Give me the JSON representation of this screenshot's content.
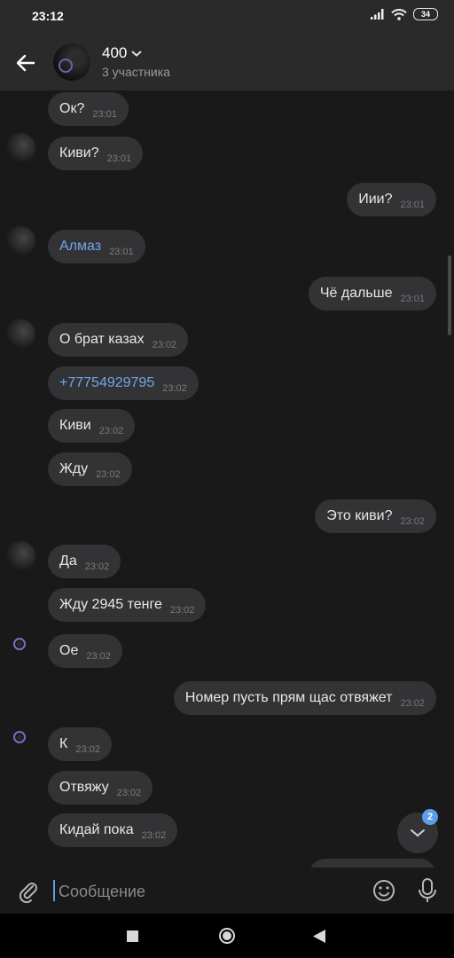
{
  "status_bar": {
    "time": "23:12",
    "battery": "34"
  },
  "header": {
    "title": "400",
    "subtitle": "3 участника",
    "icons": [
      "back-arrow-icon",
      "chevron-down-icon"
    ]
  },
  "messages": [
    {
      "side": "in",
      "text": "Ок?",
      "time": "23:01"
    },
    {
      "side": "in",
      "text": "Киви?",
      "time": "23:01"
    },
    {
      "side": "out",
      "text": "Иии?",
      "time": "23:01"
    },
    {
      "side": "in",
      "text": "Алмаз",
      "time": "23:01",
      "link": true
    },
    {
      "side": "out",
      "text": "Чё дальше",
      "time": "23:01"
    },
    {
      "side": "in",
      "text": "О брат казах",
      "time": "23:02"
    },
    {
      "side": "in",
      "text": "+77754929795",
      "time": "23:02",
      "link": true
    },
    {
      "side": "in",
      "text": "Киви",
      "time": "23:02"
    },
    {
      "side": "in",
      "text": "Жду",
      "time": "23:02"
    },
    {
      "side": "out",
      "text": "Это киви?",
      "time": "23:02"
    },
    {
      "side": "in",
      "text": "Да",
      "time": "23:02"
    },
    {
      "side": "in",
      "text": "Жду 2945 тенге",
      "time": "23:02"
    },
    {
      "side": "in",
      "text": "Ое",
      "time": "23:02"
    },
    {
      "side": "out",
      "text": "Номер пусть прям щас отвяжет",
      "time": "23:02"
    },
    {
      "side": "in",
      "text": "К",
      "time": "23:02"
    },
    {
      "side": "in",
      "text": "Отвяжу",
      "time": "23:02"
    },
    {
      "side": "in",
      "text": "Кидай пока",
      "time": "23:02"
    }
  ],
  "scroll_down": {
    "badge": "2",
    "icon": "chevron-down-icon"
  },
  "composer": {
    "placeholder": "Сообщение",
    "icons": [
      "paperclip-icon",
      "emoji-icon",
      "microphone-icon"
    ]
  },
  "navbar": {
    "icons": [
      "recents-square-icon",
      "home-circle-icon",
      "back-triangle-icon"
    ]
  },
  "colors": {
    "background": "#19191a",
    "bar": "#2a2a2b",
    "bubble": "#333335",
    "link": "#6fa7e6",
    "accent": "#5b9ee8"
  }
}
